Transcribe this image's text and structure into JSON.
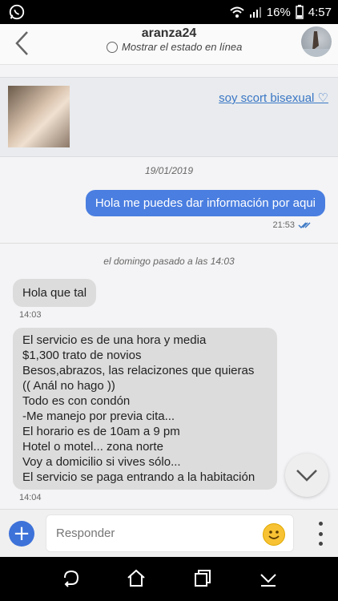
{
  "statusbar": {
    "battery": "16%",
    "time": "4:57"
  },
  "header": {
    "title": "aranza24",
    "online_label": "Mostrar el estado en línea"
  },
  "ad": {
    "link_text": "soy scort bisexual ♡"
  },
  "dates": {
    "first": "19/01/2019",
    "second": "el domingo pasado a las 14:03"
  },
  "messages": [
    {
      "direction": "out",
      "text": "Hola me puedes dar información por aqui",
      "time": "21:53"
    },
    {
      "direction": "in",
      "text": "Hola que tal",
      "time": "14:03"
    },
    {
      "direction": "in",
      "lines": [
        "El servicio es de una hora y media",
        "$1,300 trato de novios",
        "Besos,abrazos, las relacizones que quieras",
        "(( Anál no hago ))",
        "Todo es con condón",
        "-Me manejo por previa cita...",
        "El horario es de 10am a 9 pm",
        "Hotel o motel... zona norte",
        "Voy a domicilio si vives sólo...",
        "El servicio se paga entrando a la habitación"
      ],
      "time": "14:04"
    }
  ],
  "composer": {
    "placeholder": "Responder"
  },
  "colors": {
    "accent": "#4a7ee0",
    "link": "#3a77c5"
  }
}
